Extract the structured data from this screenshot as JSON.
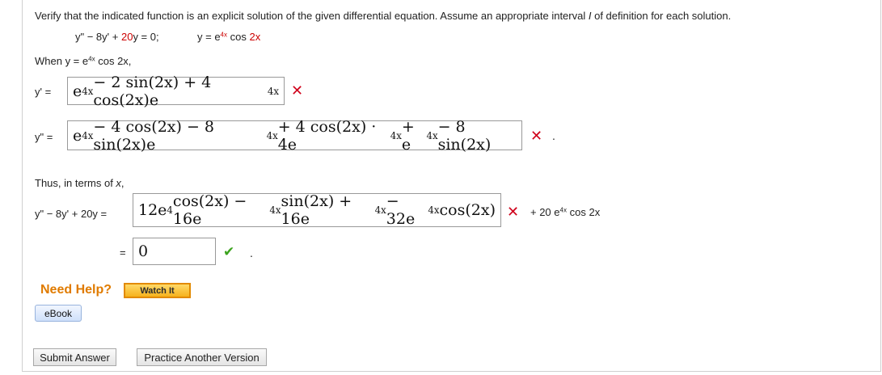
{
  "instructions": {
    "pre": "Verify that the indicated function is an explicit solution of the given differential equation. Assume an appropriate interval ",
    "var": "I",
    "post": " of definition for each solution."
  },
  "problem": {
    "eq_part1": "y\" − 8y' + ",
    "eq_red": "20",
    "eq_part2": "y = 0;",
    "func_pre": "y = e",
    "func_exp": "4x",
    "func_post": " cos ",
    "func_red": "2x"
  },
  "when": {
    "pre": "When y = e",
    "exp": "4x",
    "post": " cos 2x,"
  },
  "y_prime": {
    "label": "y' =",
    "a": "e",
    "a_exp": "4x",
    "b": " − 2 sin(2x) + 4 cos(2x)e",
    "b_exp": "4x"
  },
  "y_double": {
    "label": "y\" =",
    "a": "e",
    "a_exp": "4x",
    "b": " − 4 cos(2x) − 8 sin(2x)e",
    "b_exp": "4x",
    "c": " + 4 cos(2x) · 4e",
    "c_exp": "4x",
    "d": " + e",
    "d_exp": "4x",
    "e": " − 8 sin(2x)",
    "trail": "."
  },
  "thus": {
    "pre": "Thus, in terms of ",
    "var": "x",
    "post": ","
  },
  "combo": {
    "label": "y\" − 8y' + 20y =",
    "a": "12e",
    "a_exp": "4",
    "b": "cos(2x) − 16e",
    "b_exp": "4x",
    "c": "sin(2x) + 16e",
    "c_exp": "4x",
    "d": " − 32e",
    "d_exp": "4x",
    "e": "cos(2x)",
    "suffix_pre": "+ 20 e",
    "suffix_exp": "4x",
    "suffix_post": " cos 2x"
  },
  "final": {
    "eq": "=",
    "value": "0",
    "trail": "."
  },
  "help": {
    "title": "Need Help?",
    "watch": "Watch It",
    "ebook": "eBook"
  },
  "buttons": {
    "submit": "Submit Answer",
    "practice": "Practice Another Version"
  },
  "marks": {
    "wrong": "✕",
    "right": "✔"
  },
  "colors": {
    "accent_red": "#cc0000",
    "help_orange": "#e07b00",
    "check_green": "#3ca31e",
    "wrong_red": "#d0021b"
  }
}
